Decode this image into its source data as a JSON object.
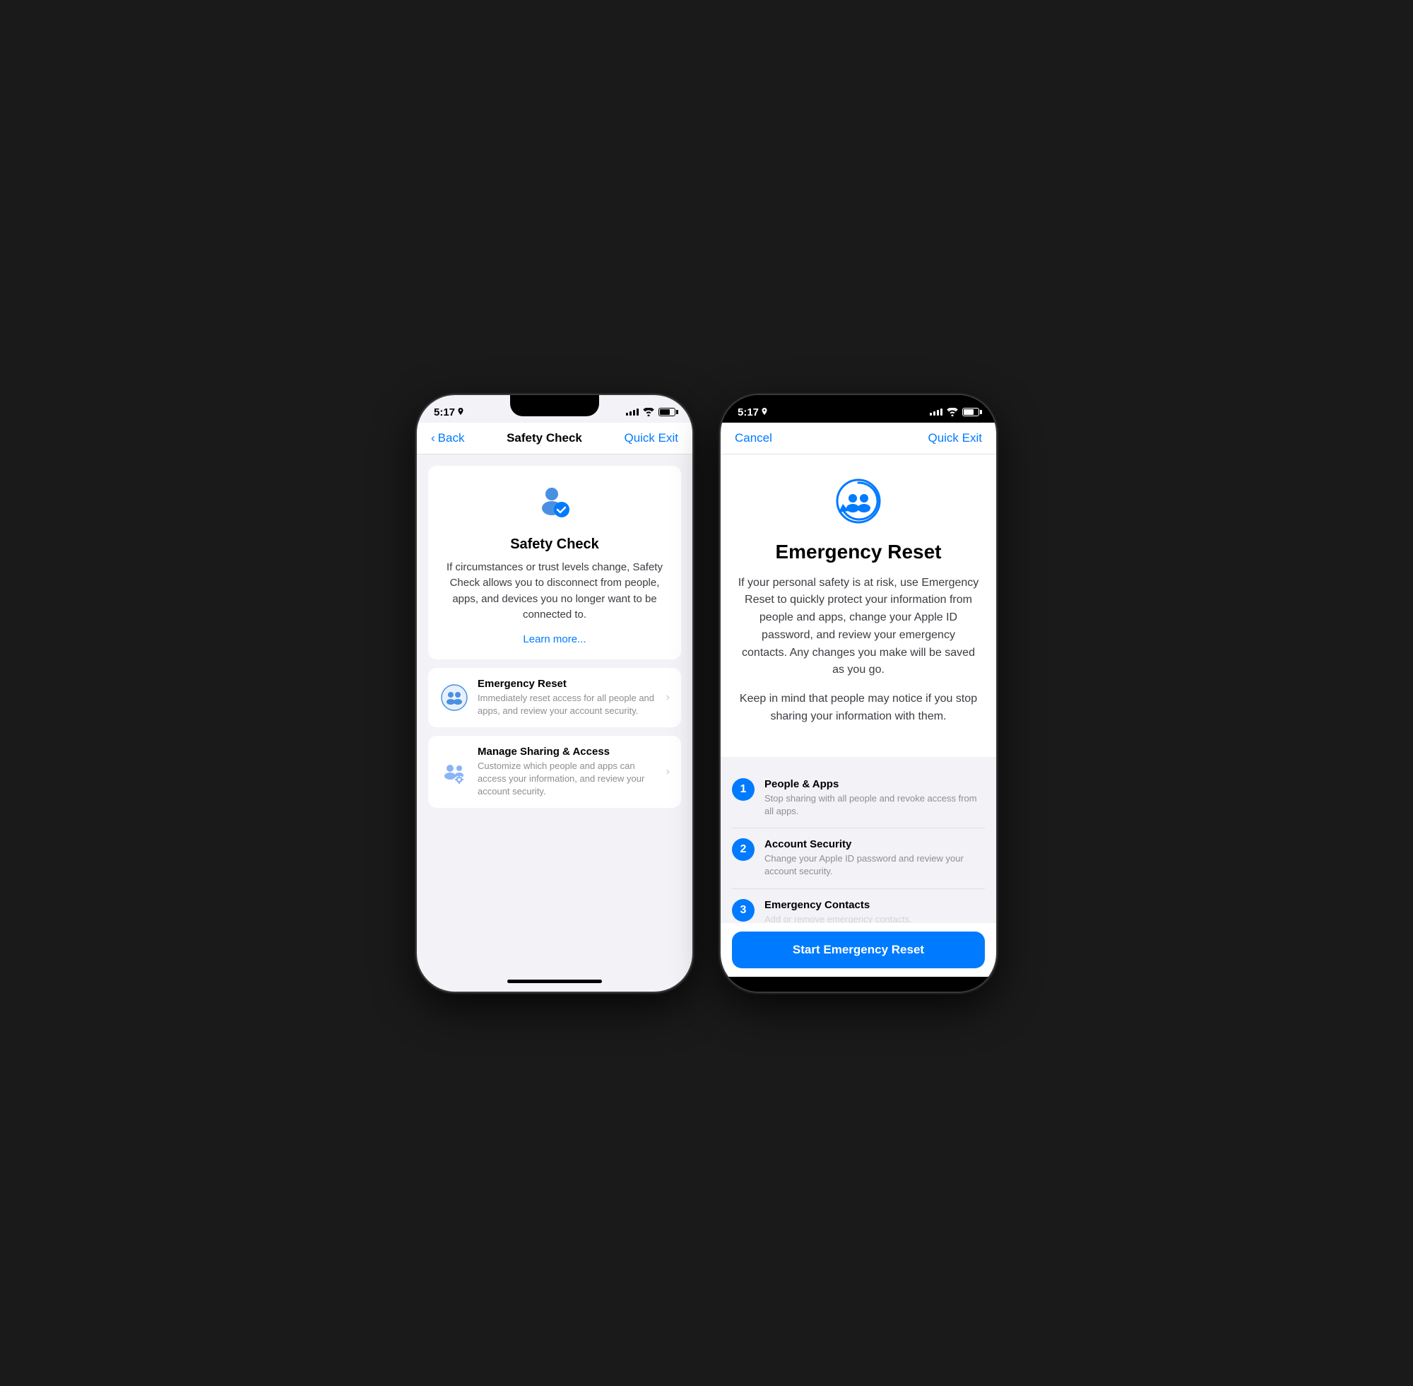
{
  "phone1": {
    "status": {
      "time": "5:17",
      "location": true
    },
    "nav": {
      "back_label": "Back",
      "title": "Safety Check",
      "action_label": "Quick Exit"
    },
    "hero": {
      "title": "Safety Check",
      "description": "If circumstances or trust levels change, Safety Check allows you to disconnect from people, apps, and devices you no longer want to be connected to.",
      "learn_more": "Learn more..."
    },
    "items": [
      {
        "title": "Emergency Reset",
        "subtitle": "Immediately reset access for all people and apps, and review your account security."
      },
      {
        "title": "Manage Sharing & Access",
        "subtitle": "Customize which people and apps can access your information, and review your account security."
      }
    ]
  },
  "phone2": {
    "status": {
      "time": "5:17"
    },
    "nav": {
      "cancel_label": "Cancel",
      "action_label": "Quick Exit"
    },
    "emergency": {
      "title": "Emergency Reset",
      "description": "If your personal safety is at risk, use Emergency Reset to quickly protect your information from people and apps, change your Apple ID password, and review your emergency contacts. Any changes you make will be saved as you go.",
      "note": "Keep in mind that people may notice if you stop sharing your information with them."
    },
    "steps": [
      {
        "number": "1",
        "title": "People & Apps",
        "subtitle": "Stop sharing with all people and revoke access from all apps."
      },
      {
        "number": "2",
        "title": "Account Security",
        "subtitle": "Change your Apple ID password and review your account security."
      },
      {
        "number": "3",
        "title": "Emergency Contacts",
        "subtitle": "Add or remove emergency contacts."
      }
    ],
    "button_label": "Start Emergency Reset"
  }
}
